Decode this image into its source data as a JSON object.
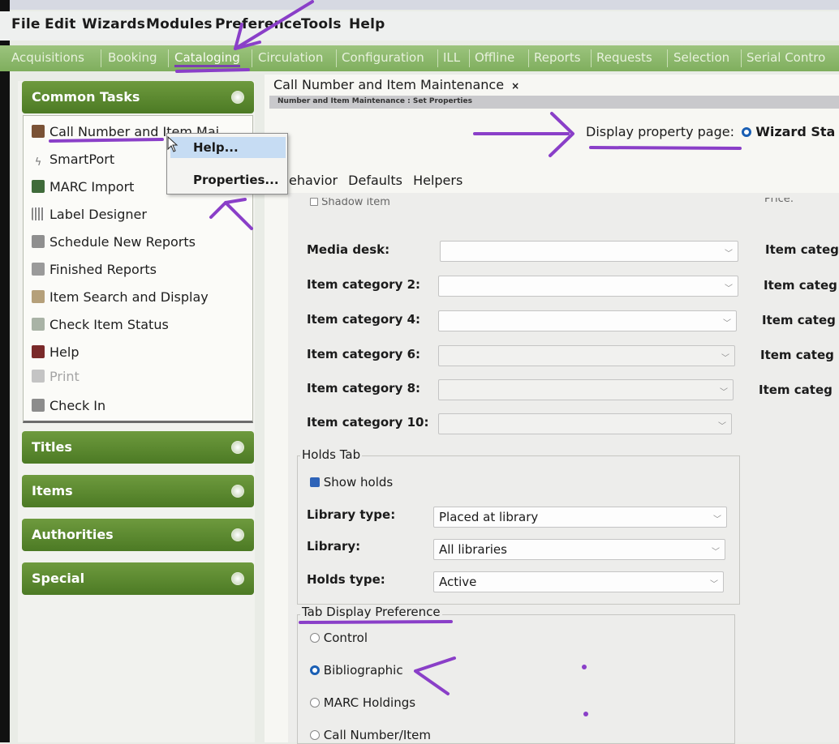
{
  "menubar": {
    "items": [
      "File",
      "Edit",
      "Wizards",
      "Modules",
      "Preference",
      "Tools",
      "Help"
    ]
  },
  "modules": [
    "Acquisitions",
    "Booking",
    "Cataloging",
    "Circulation",
    "Configuration",
    "ILL",
    "Offline",
    "Reports",
    "Requests",
    "Selection",
    "Serial Contro"
  ],
  "sidebar": {
    "common_tasks": "Common Tasks",
    "tasks": [
      "Call Number and Item Mai",
      "SmartPort",
      "MARC Import",
      "Label Designer",
      "Schedule New Reports",
      "Finished Reports",
      "Item Search and Display",
      "Check Item Status",
      "Help",
      "Print",
      "Check In"
    ],
    "groups": [
      "Titles",
      "Items",
      "Authorities",
      "Special"
    ]
  },
  "context_menu": {
    "items": [
      "Help...",
      "Properties..."
    ]
  },
  "main": {
    "tab_title": "Call Number and Item Maintenance",
    "close_glyph": "×",
    "subtitle": "Number and Item Maintenance : Set Properties",
    "display_property_label": "Display property page:",
    "display_property_value": "Wizard Sta",
    "tabs": [
      "ehavior",
      "Defaults",
      "Helpers"
    ],
    "cut_top_left": "Shadow item",
    "cut_top_right": "Price:"
  },
  "fields": [
    {
      "label": "Media desk:",
      "value": "",
      "right_label": "Item categ"
    },
    {
      "label": "Item category 2:",
      "value": "",
      "right_label": "Item categ"
    },
    {
      "label": "Item category 4:",
      "value": "",
      "right_label": "Item categ"
    },
    {
      "label": "Item category 6:",
      "value": "",
      "right_label": "Item categ"
    },
    {
      "label": "Item category 8:",
      "value": "",
      "right_label": "Item categ"
    },
    {
      "label": "Item category 10:",
      "value": ""
    }
  ],
  "holds": {
    "title": "Holds Tab",
    "show_holds": "Show holds",
    "rows": [
      {
        "label": "Library type:",
        "value": "Placed at library"
      },
      {
        "label": "Library:",
        "value": "All libraries"
      },
      {
        "label": "Holds type:",
        "value": "Active"
      }
    ]
  },
  "tab_display": {
    "title": "Tab Display Preference",
    "options": [
      "Control",
      "Bibliographic",
      "MARC Holdings",
      "Call Number/Item"
    ],
    "selected": "Bibliographic"
  },
  "colors": {
    "green": "#5a8a2e",
    "annotation": "#8a3fc8",
    "module_bar": "#8bb86a"
  }
}
